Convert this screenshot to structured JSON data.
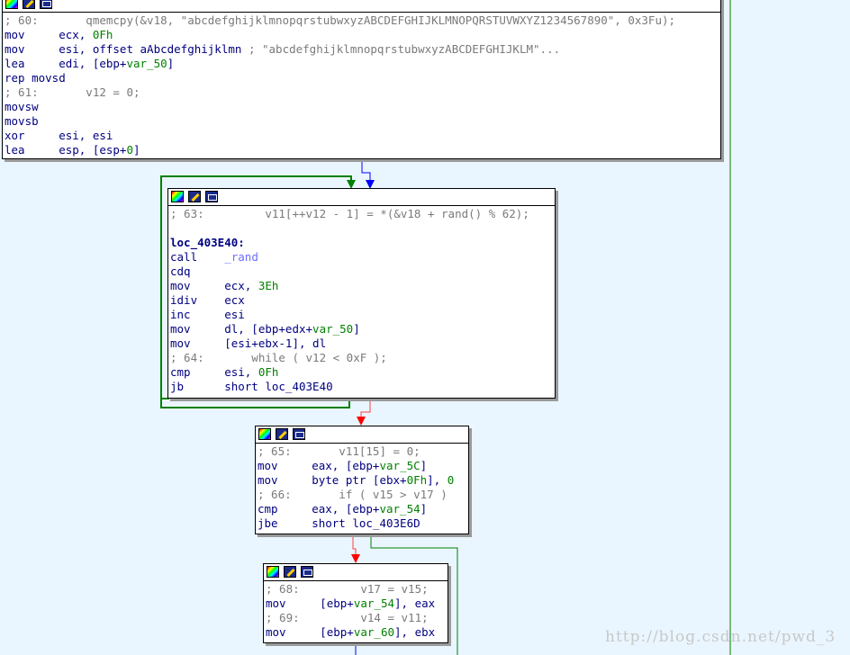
{
  "colors": {
    "graph_bg": "#eaf6ff",
    "edge_true": "#008000",
    "edge_false": "#ff0000",
    "edge_flow": "#0000ff",
    "keyword": "#000080",
    "comment": "#7a7a7a",
    "operand_num": "#008000",
    "import_func": "#6c6cff"
  },
  "node_header_icons": [
    "color-palette-icon",
    "rename-pencil-icon",
    "graph-overview-icon"
  ],
  "nodes": [
    {
      "id": "n1",
      "lines": [
        [
          {
            "t": "; 60:       qmemcpy(&v18, \"abcdefghijklmnopqrstubwxyzABCDEFGHIJKLMNOPQRSTUVWXYZ1234567890\", 0x3Fu);",
            "c": "cmt"
          }
        ],
        [
          {
            "t": "mov     ecx, ",
            "c": "reg"
          },
          {
            "t": "0Fh",
            "c": "num"
          }
        ],
        [
          {
            "t": "mov     esi, offset aAbcdefghijklmn ",
            "c": "reg"
          },
          {
            "t": "; \"abcdefghijklmnopqrstubwxyzABCDEFGHIJKLM\"...",
            "c": "str"
          }
        ],
        [
          {
            "t": "lea     edi, [ebp+",
            "c": "reg"
          },
          {
            "t": "var_50",
            "c": "var"
          },
          {
            "t": "]",
            "c": "reg"
          }
        ],
        [
          {
            "t": "rep movsd",
            "c": "reg"
          }
        ],
        [
          {
            "t": "; 61:       v12 = 0;",
            "c": "cmt"
          }
        ],
        [
          {
            "t": "movsw",
            "c": "reg"
          }
        ],
        [
          {
            "t": "movsb",
            "c": "reg"
          }
        ],
        [
          {
            "t": "xor     esi, esi",
            "c": "reg"
          }
        ],
        [
          {
            "t": "lea     esp, [esp+",
            "c": "reg"
          },
          {
            "t": "0",
            "c": "num"
          },
          {
            "t": "]",
            "c": "reg"
          }
        ]
      ]
    },
    {
      "id": "n2",
      "lines": [
        [
          {
            "t": "; 63:         v11[++v12 - 1] = *(&v18 + rand() % 62);",
            "c": "cmt"
          }
        ],
        [
          {
            "t": "",
            "c": "reg"
          }
        ],
        [
          {
            "t": "loc_403E40:",
            "c": "lbl"
          }
        ],
        [
          {
            "t": "call    ",
            "c": "reg"
          },
          {
            "t": "_rand",
            "c": "fn"
          }
        ],
        [
          {
            "t": "cdq",
            "c": "reg"
          }
        ],
        [
          {
            "t": "mov     ecx, ",
            "c": "reg"
          },
          {
            "t": "3Eh",
            "c": "num"
          }
        ],
        [
          {
            "t": "idiv    ecx",
            "c": "reg"
          }
        ],
        [
          {
            "t": "inc     esi",
            "c": "reg"
          }
        ],
        [
          {
            "t": "mov     dl, [ebp+edx+",
            "c": "reg"
          },
          {
            "t": "var_50",
            "c": "var"
          },
          {
            "t": "]",
            "c": "reg"
          }
        ],
        [
          {
            "t": "mov     [esi+ebx-1], dl",
            "c": "reg"
          }
        ],
        [
          {
            "t": "; 64:       while ( v12 < 0xF );",
            "c": "cmt"
          }
        ],
        [
          {
            "t": "cmp     esi, ",
            "c": "reg"
          },
          {
            "t": "0Fh",
            "c": "num"
          }
        ],
        [
          {
            "t": "jb      short loc_403E40",
            "c": "reg"
          }
        ]
      ]
    },
    {
      "id": "n3",
      "lines": [
        [
          {
            "t": "; 65:       v11[15] = 0;",
            "c": "cmt"
          }
        ],
        [
          {
            "t": "mov     eax, [ebp+",
            "c": "reg"
          },
          {
            "t": "var_5C",
            "c": "var"
          },
          {
            "t": "]",
            "c": "reg"
          }
        ],
        [
          {
            "t": "mov     byte ptr [ebx+",
            "c": "reg"
          },
          {
            "t": "0Fh",
            "c": "num"
          },
          {
            "t": "], ",
            "c": "reg"
          },
          {
            "t": "0",
            "c": "num"
          }
        ],
        [
          {
            "t": "; 66:       if ( v15 > v17 )",
            "c": "cmt"
          }
        ],
        [
          {
            "t": "cmp     eax, [ebp+",
            "c": "reg"
          },
          {
            "t": "var_54",
            "c": "var"
          },
          {
            "t": "]",
            "c": "reg"
          }
        ],
        [
          {
            "t": "jbe     short loc_403E6D",
            "c": "reg"
          }
        ]
      ]
    },
    {
      "id": "n4",
      "lines": [
        [
          {
            "t": "; 68:         v17 = v15;",
            "c": "cmt"
          }
        ],
        [
          {
            "t": "mov     [ebp+",
            "c": "reg"
          },
          {
            "t": "var_54",
            "c": "var"
          },
          {
            "t": "], eax",
            "c": "reg"
          }
        ],
        [
          {
            "t": "; 69:         v14 = v11;",
            "c": "cmt"
          }
        ],
        [
          {
            "t": "mov     [ebp+",
            "c": "reg"
          },
          {
            "t": "var_60",
            "c": "var"
          },
          {
            "t": "], ebx",
            "c": "reg"
          }
        ]
      ]
    }
  ],
  "watermark": "http://blog.csdn.net/pwd_3"
}
